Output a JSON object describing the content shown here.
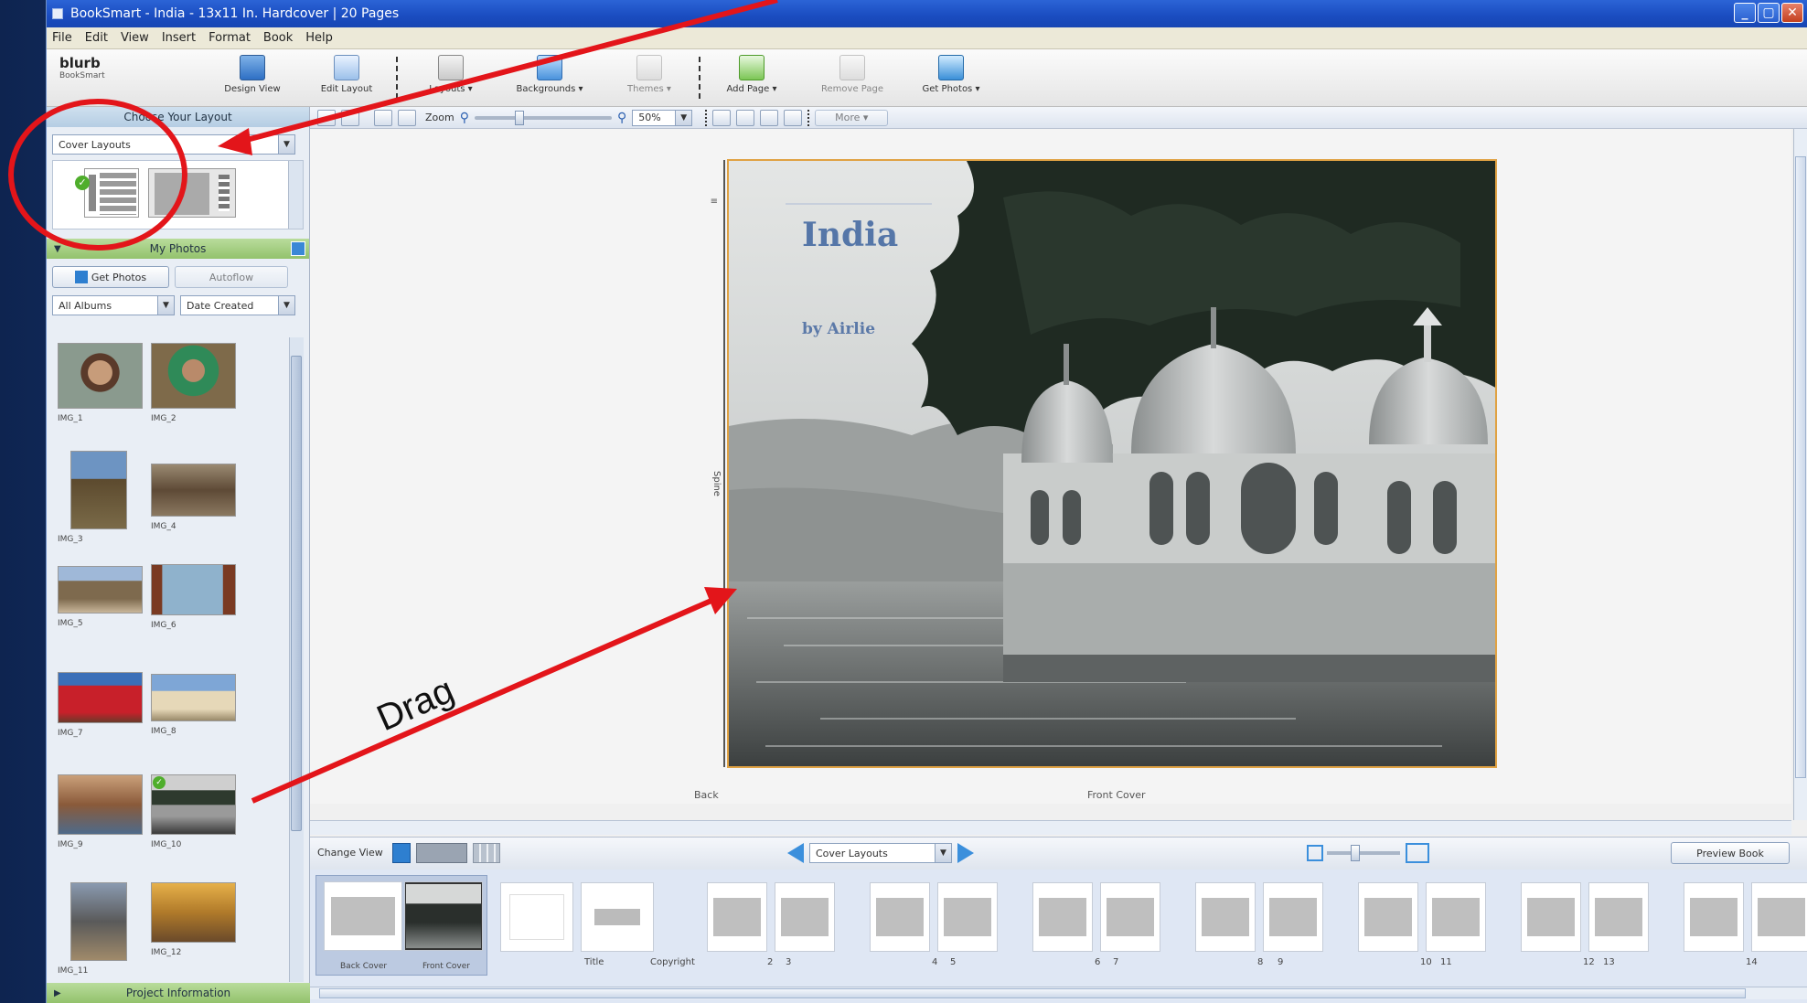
{
  "window": {
    "title": "BookSmart - India - 13x11 In. Hardcover | 20 Pages",
    "controls": [
      "_",
      "▢",
      "✕"
    ]
  },
  "menu": [
    "File",
    "Edit",
    "View",
    "Insert",
    "Format",
    "Book",
    "Help"
  ],
  "toolbar": {
    "logo_text": "blurb",
    "logo_sub": "BookSmart",
    "items": [
      "Design View",
      "Edit Layout",
      "Layouts ▾",
      "Backgrounds ▾",
      "Themes ▾",
      "Add Page ▾",
      "Remove Page",
      "Get Photos ▾"
    ]
  },
  "left_panel": {
    "layout_header": "Choose Your Layout",
    "layout_dropdown": "Cover Layouts",
    "photos_header": "My Photos",
    "get_photos_btn": "Get Photos",
    "autoflow_btn": "Autoflow",
    "filter_dropdown": "All Albums",
    "sort_dropdown": "Date Created",
    "photo_captions": [
      [
        "IMG_1",
        "IMG_2"
      ],
      [
        "IMG_3",
        "IMG_4"
      ],
      [
        "IMG_5",
        "IMG_6"
      ],
      [
        "IMG_7",
        "IMG_8"
      ],
      [
        "IMG_9",
        "IMG_10"
      ],
      [
        "IMG_11",
        "IMG_12"
      ]
    ],
    "footer_header": "Project Information"
  },
  "viewbar": {
    "zoom_label": "Zoom",
    "zoom_value": "50%",
    "more_btn": "More ▾"
  },
  "page": {
    "title": "India",
    "byline": "by Airlie",
    "spine_label": "Spine",
    "left_caption": "Back",
    "right_caption": "Front Cover"
  },
  "bottombar": {
    "view_label": "Change View",
    "section_dropdown": "Cover Layouts",
    "preview_btn": "Preview Book"
  },
  "filmstrip": {
    "labels": [
      "Back Cover",
      "Front Cover",
      "Title",
      "Copyright",
      "2",
      "3",
      "4",
      "5",
      "6",
      "7",
      "8",
      "9",
      "10",
      "11",
      "12",
      "13",
      "14"
    ]
  },
  "annotation": {
    "drag_label": "Drag",
    "arrow_color": "#e3151a",
    "circle_color": "#e3151a"
  }
}
